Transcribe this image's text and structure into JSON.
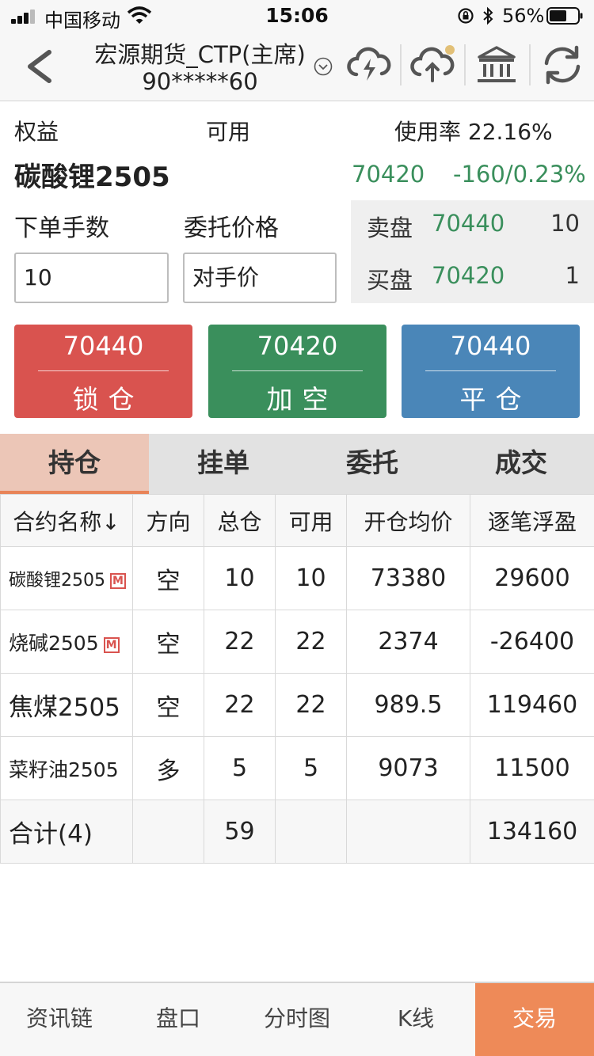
{
  "status_bar": {
    "carrier": "中国移动",
    "time": "15:06",
    "battery": "56%"
  },
  "header": {
    "title": "宏源期货_CTP(主席)",
    "account_id": "90*****60",
    "icons": [
      "back-icon",
      "dropdown-icon",
      "cloud-lightning-icon",
      "cloud-upload-icon",
      "bank-icon",
      "refresh-icon"
    ]
  },
  "summary": {
    "equity_label": "权益",
    "available_label": "可用",
    "usage": "使用率 22.16%"
  },
  "instrument": {
    "name": "碳酸锂2505",
    "last_price": "70420",
    "change": "-160/0.23%"
  },
  "order_form": {
    "qty_label": "下单手数",
    "price_label": "委托价格",
    "qty_value": "10",
    "price_value": "对手价"
  },
  "order_book": {
    "ask_label": "卖盘",
    "ask_price": "70440",
    "ask_qty": "10",
    "bid_label": "买盘",
    "bid_price": "70420",
    "bid_qty": "1"
  },
  "trade_buttons": [
    {
      "price": "70440",
      "label": "锁仓",
      "color": "#d9534f"
    },
    {
      "price": "70420",
      "label": "加空",
      "color": "#3a8f5c"
    },
    {
      "price": "70440",
      "label": "平仓",
      "color": "#4a86b8"
    }
  ],
  "tabs": [
    "持仓",
    "挂单",
    "委托",
    "成交"
  ],
  "positions": {
    "headers": [
      "合约名称↓",
      "方向",
      "总仓",
      "可用",
      "开仓均价",
      "逐笔浮盈"
    ],
    "rows": [
      {
        "name": "碳酸锂2505",
        "badge": "M",
        "dir": "空",
        "total": "10",
        "avail": "10",
        "avg": "73380",
        "pnl": "29600"
      },
      {
        "name": "烧碱2505",
        "badge": "M",
        "dir": "空",
        "total": "22",
        "avail": "22",
        "avg": "2374",
        "pnl": "-26400"
      },
      {
        "name": "焦煤2505",
        "badge": "",
        "dir": "空",
        "total": "22",
        "avail": "22",
        "avg": "989.5",
        "pnl": "119460"
      },
      {
        "name": "菜籽油2505",
        "badge": "",
        "dir": "多",
        "total": "5",
        "avail": "5",
        "avg": "9073",
        "pnl": "11500"
      }
    ],
    "total": {
      "name": "合计(4)",
      "total": "59",
      "pnl": "134160"
    }
  },
  "bottom_nav": [
    "资讯链",
    "盘口",
    "分时图",
    "K线",
    "交易"
  ],
  "colors": {
    "up": "#d9534f",
    "down": "#3a8f5c",
    "accent": "#ee8a58"
  }
}
